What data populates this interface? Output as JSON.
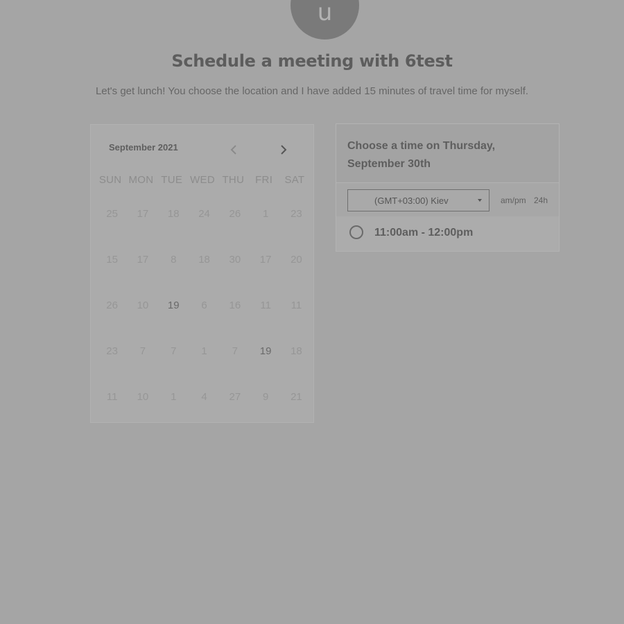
{
  "header": {
    "avatar_letter": "u",
    "title": "Schedule a meeting with 6test",
    "description": "Let's get lunch! You choose the location and I have added 15 minutes of travel time for myself."
  },
  "calendar": {
    "month_label": "September 2021",
    "prev_icon": "chevron-left-icon",
    "next_icon": "chevron-right-icon",
    "weekdays": [
      "SUN",
      "MON",
      "TUE",
      "WED",
      "THU",
      "FRI",
      "SAT"
    ],
    "weeks": [
      [
        "25",
        "17",
        "18",
        "24",
        "26",
        "1",
        "23"
      ],
      [
        "15",
        "17",
        "8",
        "18",
        "30",
        "17",
        "20"
      ],
      [
        "26",
        "10",
        "19",
        "6",
        "16",
        "11",
        "11"
      ],
      [
        "23",
        "7",
        "7",
        "1",
        "7",
        "19",
        "18"
      ],
      [
        "11",
        "10",
        "1",
        "4",
        "27",
        "9",
        "21"
      ]
    ],
    "active_days": [
      "19"
    ]
  },
  "time_panel": {
    "title": "Choose a time on Thursday, September 30th",
    "timezone": "(GMT+03:00) Kiev",
    "format_ampm": "am/pm",
    "format_24h": "24h",
    "slots": [
      "11:00am - 12:00pm"
    ]
  },
  "colors": {
    "overlay_background": "#a5a5a5",
    "text_dark": "#5e5e5e",
    "text_muted": "#969696"
  }
}
